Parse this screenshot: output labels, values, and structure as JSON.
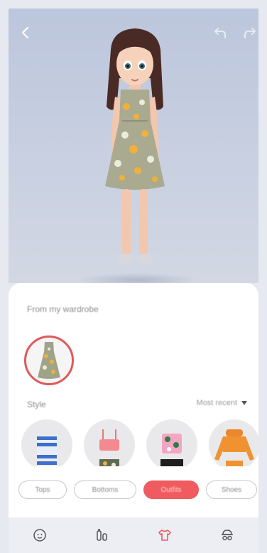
{
  "header": {
    "back_icon": "chevron-left-icon",
    "undo_icon": "undo-icon",
    "redo_icon": "redo-icon"
  },
  "panel": {
    "wardrobe_label": "From my wardrobe",
    "style_label": "Style",
    "style_value": "Most recent",
    "selected_item": "dress"
  },
  "categories": [
    {
      "label": "Tops",
      "active": false
    },
    {
      "label": "Bottoms",
      "active": false
    },
    {
      "label": "Outfits",
      "active": true
    },
    {
      "label": "Shoes",
      "active": false
    }
  ],
  "items": [
    {
      "name": "striped-top"
    },
    {
      "name": "pink-crop-top"
    },
    {
      "name": "floral-top"
    },
    {
      "name": "orange-crop-top"
    }
  ],
  "nav": [
    {
      "icon": "face-icon"
    },
    {
      "icon": "body-icon"
    },
    {
      "icon": "shirt-icon",
      "active": true
    },
    {
      "icon": "accessory-icon"
    }
  ],
  "colors": {
    "accent": "#ef5b5e",
    "background": "#bcc6dc"
  }
}
